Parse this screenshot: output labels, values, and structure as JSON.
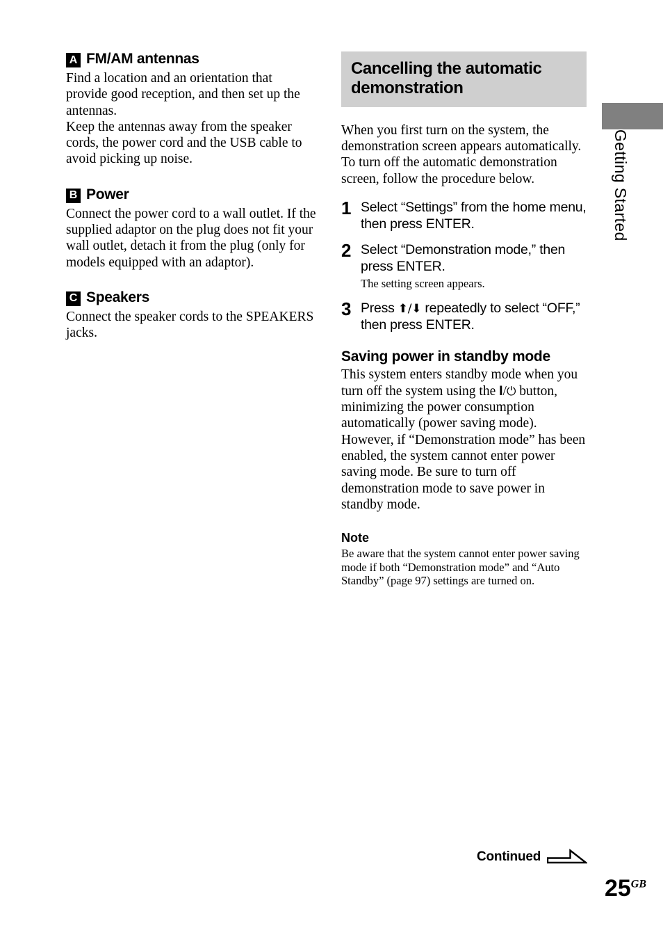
{
  "page": {
    "number": "25",
    "number_suffix": "GB",
    "continued_label": "Continued",
    "side_tab_label": "Getting Started"
  },
  "left_column": {
    "sections": [
      {
        "badge": "A",
        "heading": "FM/AM antennas",
        "paragraphs": [
          "Find a location and an orientation that provide good reception, and then set up the antennas.",
          "Keep the antennas away from the speaker cords, the power cord and the USB cable to avoid picking up noise."
        ]
      },
      {
        "badge": "B",
        "heading": "Power",
        "paragraphs": [
          "Connect the power cord to a wall outlet. If the supplied adaptor on the plug does not fit your wall outlet, detach it from the plug (only for models equipped with an adaptor)."
        ]
      },
      {
        "badge": "C",
        "heading": "Speakers",
        "paragraphs": [
          "Connect the speaker cords to the SPEAKERS jacks."
        ]
      }
    ]
  },
  "right_column": {
    "banner_title": "Cancelling the automatic demonstration",
    "intro": "When you first turn on the system, the demonstration screen appears automatically.\nTo turn off the automatic demonstration screen, follow the procedure below.",
    "steps": [
      {
        "number": "1",
        "text": "Select “Settings” from the home menu, then press ENTER.",
        "sub": ""
      },
      {
        "number": "2",
        "text": "Select “Demonstration mode,” then press ENTER.",
        "sub": "The setting screen appears."
      },
      {
        "number": "3",
        "text_before": "Press ",
        "arrows": "⬆/⬇",
        "text_after": " repeatedly to select “OFF,” then press ENTER.",
        "sub": ""
      }
    ],
    "subsection": {
      "heading": "Saving power in standby mode",
      "text_before": "This system enters standby mode when you turn off the system using the ",
      "power_symbol_i": "I",
      "power_symbol_slash": "/",
      "power_symbol_standby": "⏻",
      "text_after": " button, minimizing the power consumption automatically (power saving mode). However, if “Demonstration mode” has been enabled, the system cannot enter power saving mode. Be sure to turn off demonstration mode to save power in standby mode."
    },
    "note": {
      "heading": "Note",
      "text": "Be aware that the system cannot enter power saving mode if both “Demonstration mode” and “Auto Standby” (page 97) settings are turned on."
    }
  },
  "colors": {
    "banner_background": "#cfcfcf",
    "tab_block": "#808080",
    "badge_background": "#000000",
    "text": "#000000"
  }
}
